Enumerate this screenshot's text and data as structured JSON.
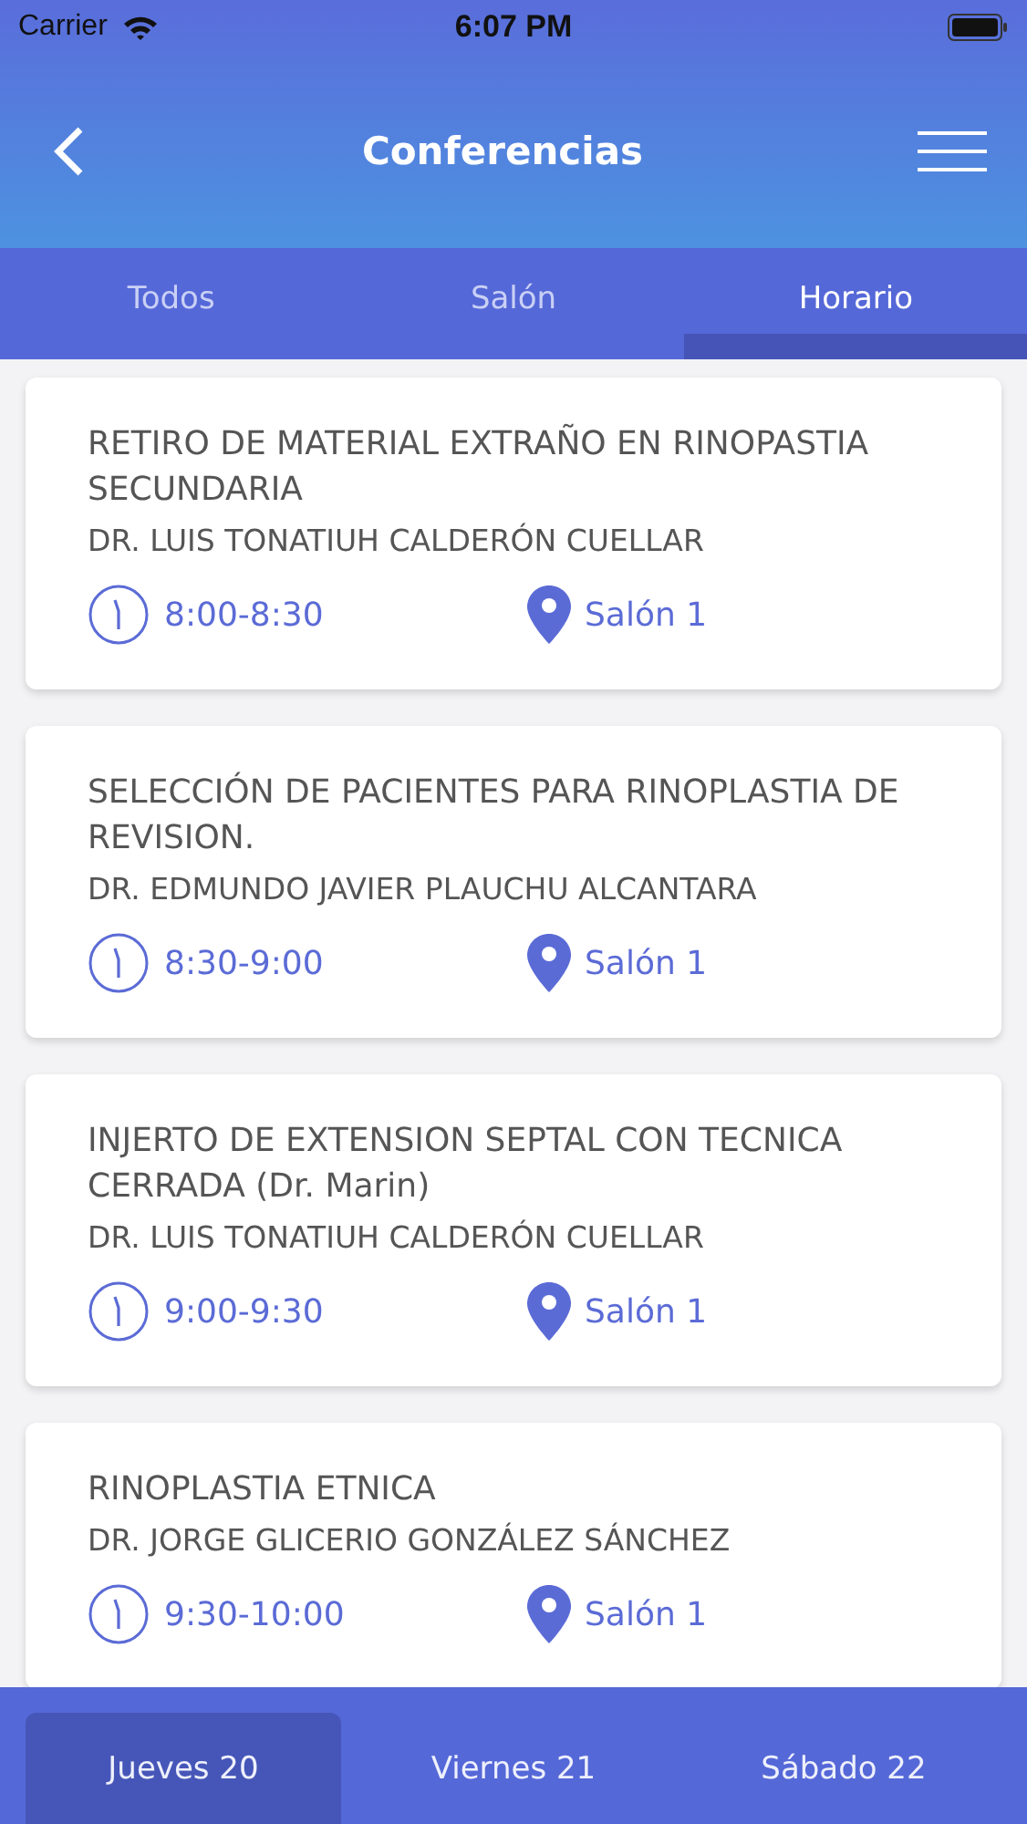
{
  "status_bar": {
    "carrier": "Carrier",
    "time": "6:07 PM"
  },
  "header": {
    "title": "Conferencias"
  },
  "tabs": [
    {
      "label": "Todos",
      "selected": false
    },
    {
      "label": "Salón",
      "selected": false
    },
    {
      "label": "Horario",
      "selected": true
    }
  ],
  "sessions": [
    {
      "title": "RETIRO DE MATERIAL EXTRAÑO EN RINOPASTIA SECUNDARIA",
      "speaker": "DR. LUIS TONATIUH CALDERÓN CUELLAR",
      "time": "8:00-8:30",
      "room": "Salón 1"
    },
    {
      "title": "SELECCIÓN DE PACIENTES PARA RINOPLASTIA DE REVISION.",
      "speaker": "DR. EDMUNDO JAVIER PLAUCHU ALCANTARA",
      "time": "8:30-9:00",
      "room": "Salón 1"
    },
    {
      "title": "INJERTO DE EXTENSION SEPTAL CON TECNICA CERRADA (Dr. Marin)",
      "speaker": "DR. LUIS TONATIUH CALDERÓN CUELLAR",
      "time": "9:00-9:30",
      "room": "Salón 1"
    },
    {
      "title": "RINOPLASTIA ETNICA",
      "speaker": "DR. JORGE GLICERIO GONZÁLEZ SÁNCHEZ",
      "time": "9:30-10:00",
      "room": "Salón 1"
    }
  ],
  "days": [
    {
      "label": "Jueves 20",
      "selected": true
    },
    {
      "label": "Viernes 21",
      "selected": false
    },
    {
      "label": "Sábado 22",
      "selected": false
    }
  ]
}
